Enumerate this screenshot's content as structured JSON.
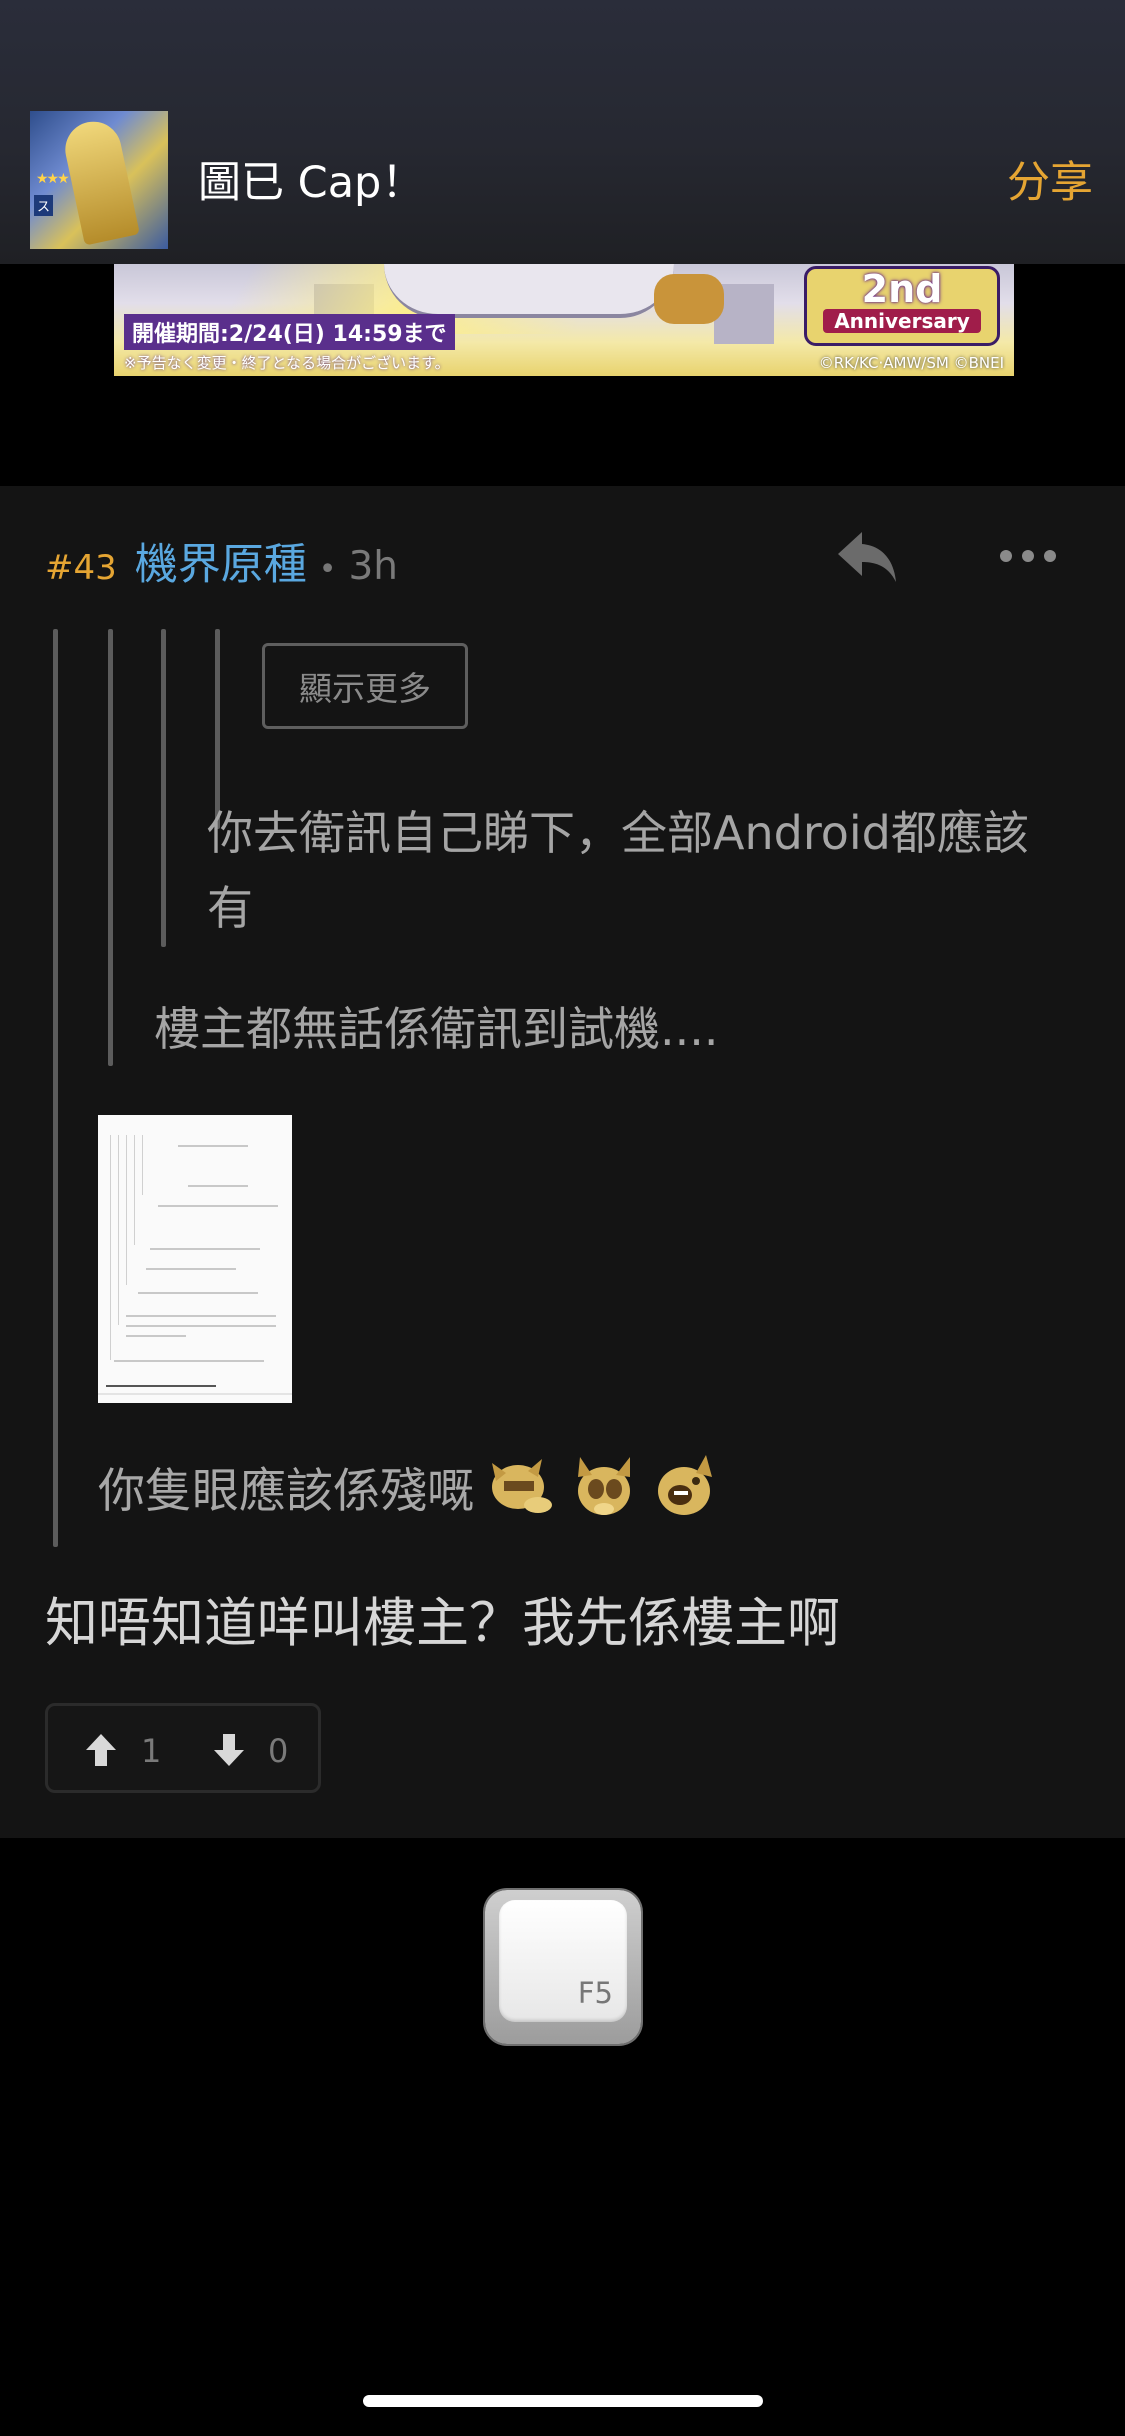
{
  "header": {
    "title": "圖已 Cap！",
    "share_label": "分享",
    "thumbnail_icon": "anime-thumbnail",
    "accent_color": "#e5a533"
  },
  "banner": {
    "period": "開催期間:2/24(日) 14:59まで",
    "note": "※予告なく変更・終了となる場合がございます。",
    "badge_top": "2nd",
    "badge_bottom": "Anniversary",
    "copyright": "©RK/KC·AMW/SM ©BNEI"
  },
  "post": {
    "number": "#43",
    "username": "機界原種",
    "separator": "•",
    "time": "3h",
    "reply_icon": "reply-icon",
    "more_icon": "more-icon",
    "show_more_label": "顯示更多",
    "quote_deep": "你去衛訊自己睇下，全部Android都應該有",
    "quote_mid": "樓主都無話係衛訊到試機....",
    "quote_text": "你隻眼應該係殘嘅",
    "body": "知唔知道咩叫樓主？我先係樓主啊",
    "votes": {
      "up_count": "1",
      "down_count": "0"
    },
    "username_color": "#5aa8e0"
  },
  "overlay": {
    "key_label": "F5"
  }
}
